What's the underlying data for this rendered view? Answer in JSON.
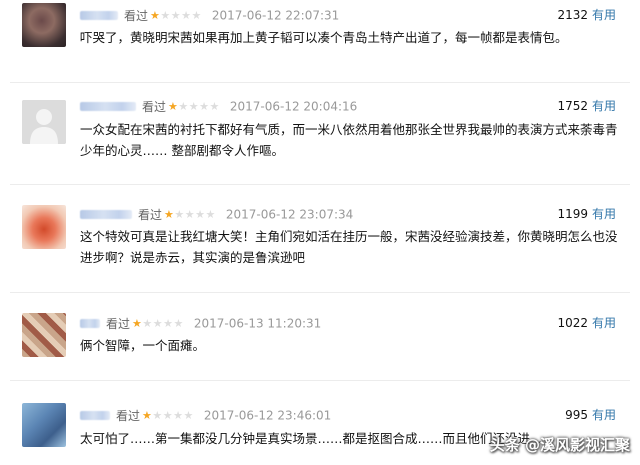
{
  "comments": [
    {
      "status": "看过",
      "rating": 1,
      "time": "2017-06-12 22:07:31",
      "votes": "2132",
      "useful": "有用",
      "text": "吓哭了，黄晓明宋茜如果再加上黄子韬可以凑个青岛土特产出道了，每一帧都是表情包。"
    },
    {
      "status": "看过",
      "rating": 1,
      "time": "2017-06-12 20:04:16",
      "votes": "1752",
      "useful": "有用",
      "text": "一众女配在宋茜的衬托下都好有气质，而一米八依然用着他那张全世界我最帅的表演方式来荼毒青少年的心灵…… 整部剧都令人作嘔。"
    },
    {
      "status": "看过",
      "rating": 1,
      "time": "2017-06-12 23:07:34",
      "votes": "1199",
      "useful": "有用",
      "text": "这个特效可真是让我红塘大笑！主角们宛如活在挂历一般，宋茜没经验演技差，你黄晓明怎么也没进步啊？说是赤云，其实演的是鲁滨逊吧"
    },
    {
      "status": "看过",
      "rating": 1,
      "time": "2017-06-13 11:20:31",
      "votes": "1022",
      "useful": "有用",
      "text": "俩个智障，一个面瘫。"
    },
    {
      "status": "看过",
      "rating": 1,
      "time": "2017-06-12 23:46:01",
      "votes": "995",
      "useful": "有用",
      "text": "太可怕了……第一集都没几分钟是真实场景……都是抠图合成……而且他们还没进..."
    }
  ],
  "watermark": "头条 @溪风影视汇聚",
  "colors": {
    "star_on": "#f5a623",
    "star_off": "#dddddd",
    "link": "#3377aa"
  }
}
